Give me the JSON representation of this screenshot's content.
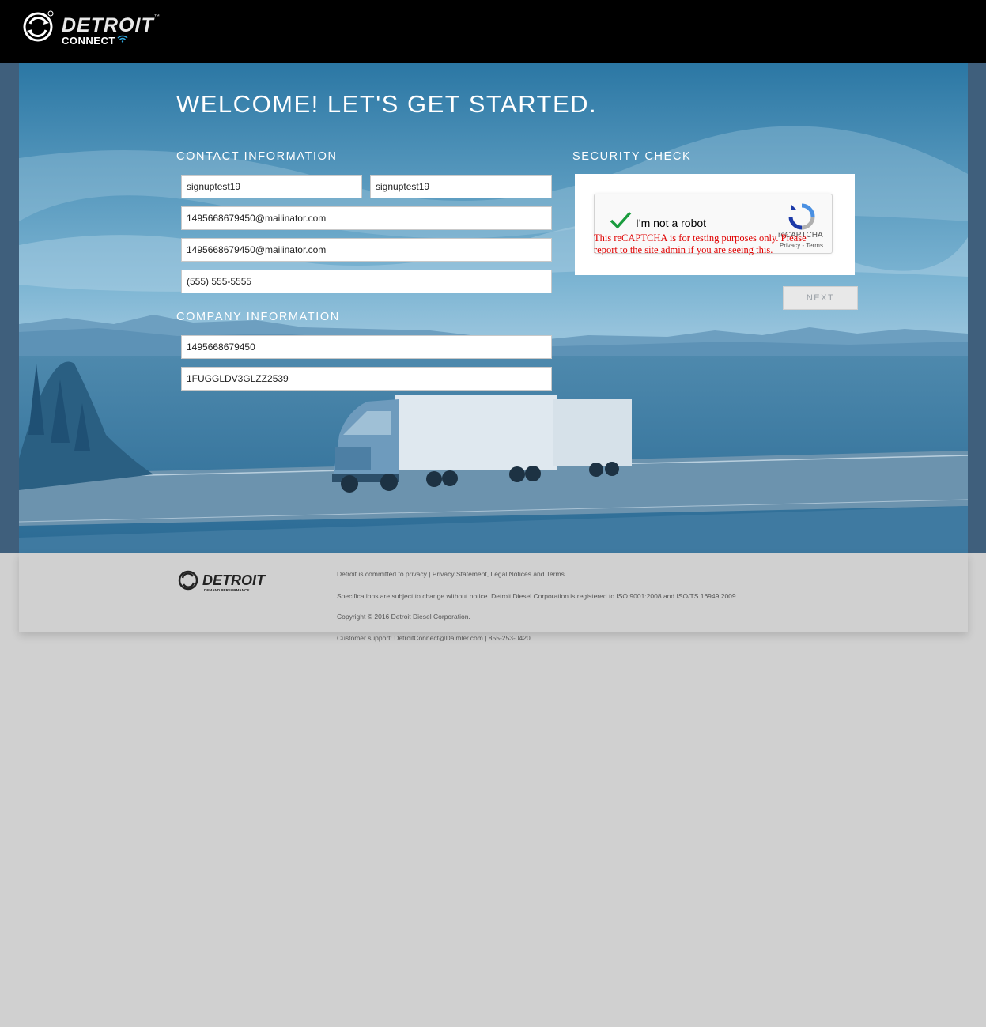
{
  "header": {
    "logo_brand": "DETROIT",
    "logo_sub": "CONNECT",
    "logo_tm": "™"
  },
  "page_title": "WELCOME! LET'S GET STARTED.",
  "contact": {
    "heading": "CONTACT INFORMATION",
    "first_name": "signuptest19",
    "last_name": "signuptest19",
    "email": "1495668679450@mailinator.com",
    "email_confirm": "1495668679450@mailinator.com",
    "phone": "(555) 555-5555"
  },
  "company": {
    "heading": "COMPANY INFORMATION",
    "company_id": "1495668679450",
    "vin": "1FUGGLDV3GLZZ2539"
  },
  "security": {
    "heading": "SECURITY CHECK",
    "checkbox_label": "I'm not a robot",
    "brand": "reCAPTCHA",
    "links": "Privacy - Terms",
    "warning": "This reCAPTCHA is for testing purposes only. Please report to the site admin if you are seeing this.",
    "checked": true
  },
  "next_button": "NEXT",
  "footer": {
    "logo_brand": "DETROIT",
    "logo_tagline": "DEMAND PERFORMANCE",
    "line1": "Detroit is committed to privacy | Privacy Statement, Legal Notices and Terms.",
    "line2": "Specifications are subject to change without notice. Detroit Diesel Corporation is registered to ISO 9001:2008 and ISO/TS 16949:2009.",
    "line3": "Copyright © 2016 Detroit Diesel Corporation.",
    "line4": "Customer support: DetroitConnect@Daimler.com | 855-253-0420"
  },
  "colors": {
    "topbar": "#000000",
    "hero_blue": "#3a82ad",
    "page_bg": "#d0d0d0",
    "check_green": "#1a9c3e",
    "warning_red": "#e00000"
  }
}
